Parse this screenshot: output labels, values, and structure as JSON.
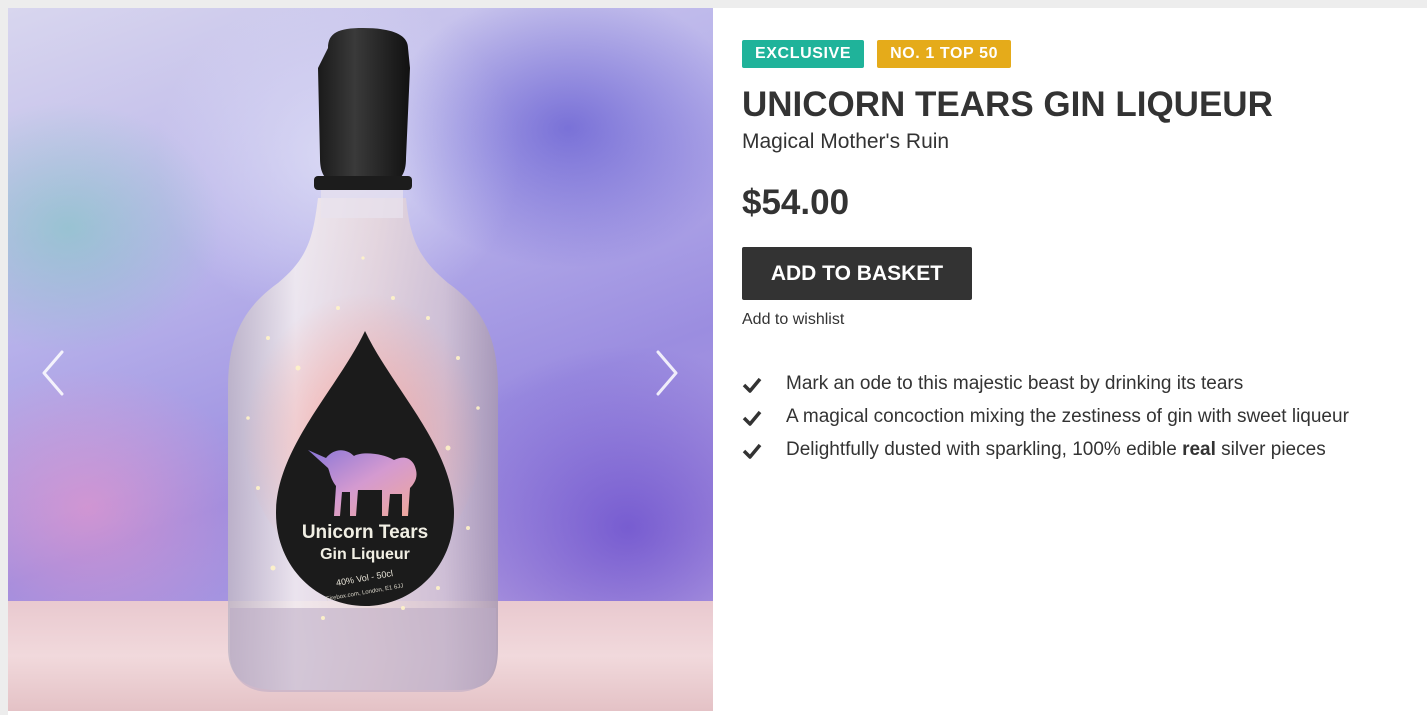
{
  "product": {
    "badges": [
      {
        "label": "EXCLUSIVE",
        "color": "#1fb39a"
      },
      {
        "label": "NO. 1 TOP 50",
        "color": "#e5ab1a"
      }
    ],
    "title": "UNICORN TEARS GIN LIQUEUR",
    "subtitle": "Magical Mother's Ruin",
    "price": "$54.00",
    "add_to_basket_label": "ADD TO BASKET",
    "wishlist_label": "Add to wishlist",
    "features": [
      {
        "text": "Mark an ode to this majestic beast by drinking its tears"
      },
      {
        "text": "A magical concoction mixing the zestiness of gin with sweet liqueur"
      },
      {
        "text_before": "Delightfully dusted with sparkling, 100% edible ",
        "text_bold": "real",
        "text_after": " silver pieces"
      }
    ]
  },
  "image": {
    "label_line1": "Unicorn Tears",
    "label_line2": "Gin Liqueur",
    "label_line3": "40% Vol  -  50cl",
    "label_line4": "Firebox.com, London, E1 6JJ"
  },
  "carousel": {
    "prev_icon": "chevron-left-icon",
    "next_icon": "chevron-right-icon"
  },
  "colors": {
    "text": "#333333",
    "button_bg": "#333333",
    "badge_exclusive": "#1fb39a",
    "badge_top50": "#e5ab1a"
  }
}
